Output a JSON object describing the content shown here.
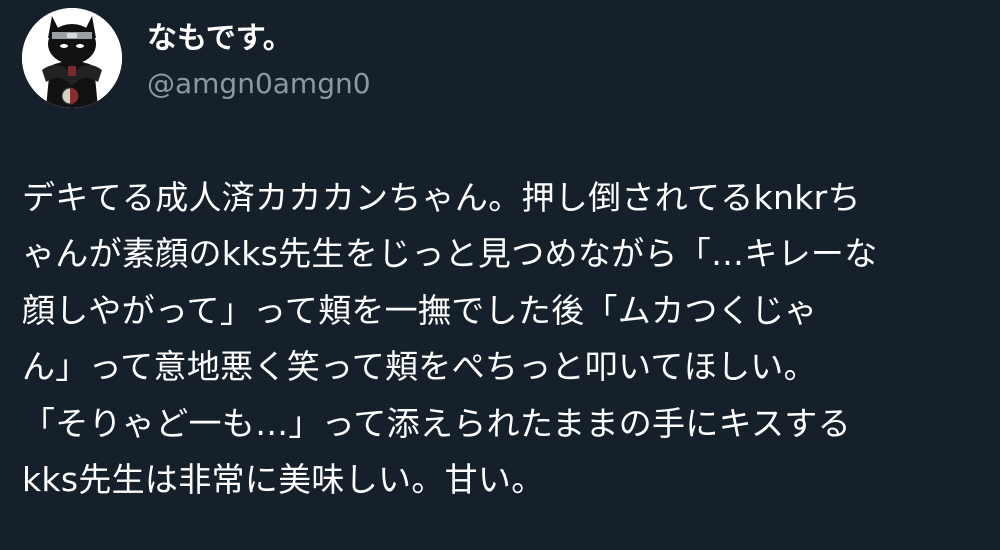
{
  "user": {
    "display_name": "なもです。",
    "handle": "@amgn0amgn0",
    "avatar_icon": "cat-character-avatar-icon"
  },
  "tweet": {
    "lines": [
      "デキてる成人済カカカンちゃん。押し倒されてるknkrち",
      "ゃんが素顔のkks先生をじっと見つめながら「…キレーな",
      "顔しやがって」って頬を一撫でした後「ムカつくじゃ",
      "ん」って意地悪く笑って頬をぺちっと叩いてほしい。",
      "「そりゃど一も…」って添えられたままの手にキスする",
      "kks先生は非常に美味しい。甘い。"
    ]
  },
  "colors": {
    "background": "#15202b",
    "primary_text": "#ffffff",
    "secondary_text": "#8b98a5"
  }
}
